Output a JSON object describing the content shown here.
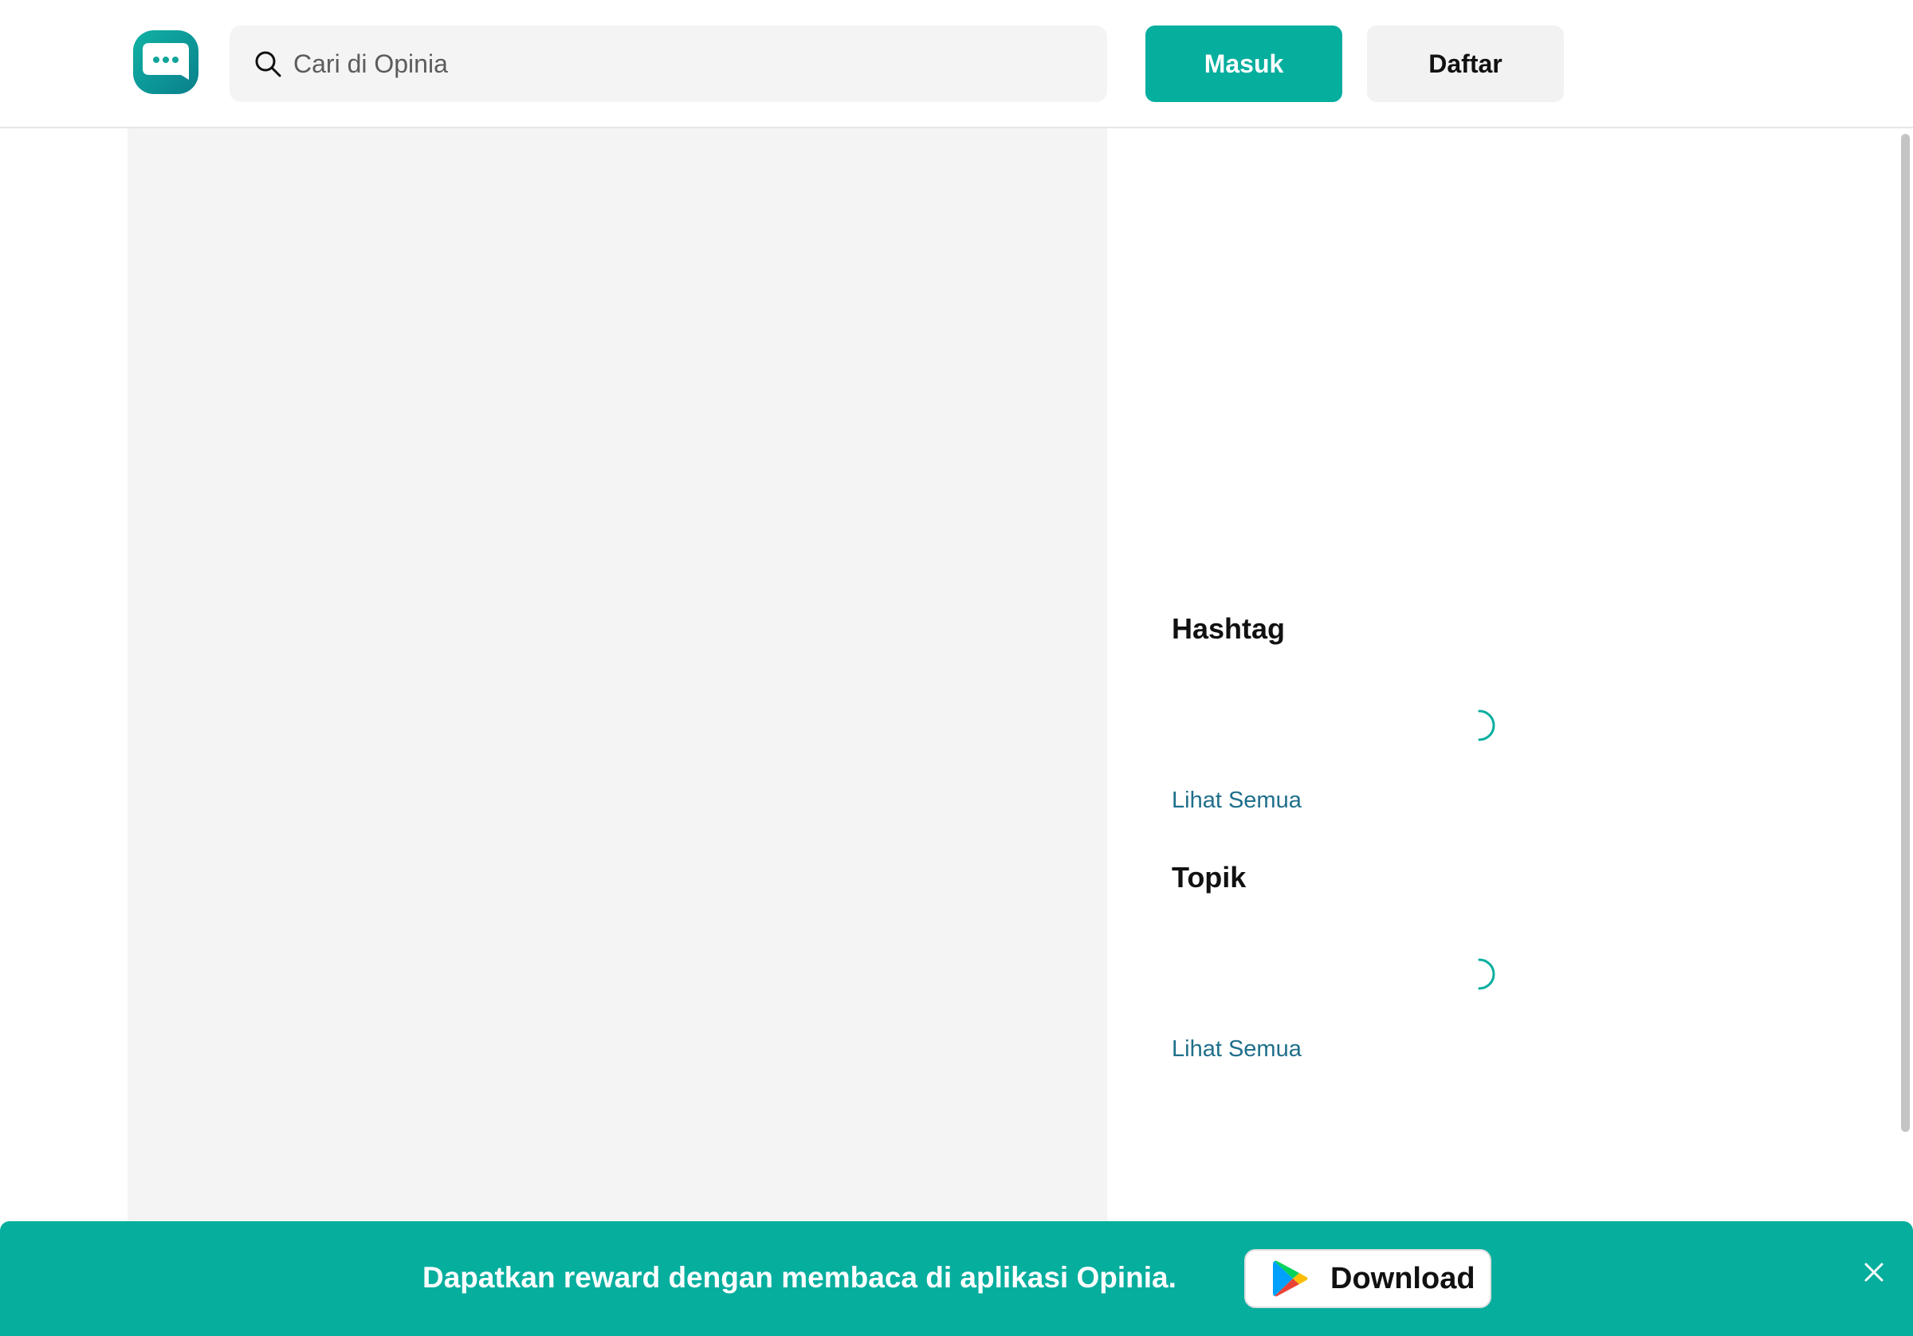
{
  "app": {
    "name": "Opinia",
    "accent_color": "#06ae9e"
  },
  "header": {
    "logo_icon": "opinia-chat-bubble-icon",
    "search": {
      "placeholder": "Cari di Opinia",
      "value": "",
      "icon": "search-icon"
    },
    "login_label": "Masuk",
    "register_label": "Daftar"
  },
  "sidebar": {
    "hashtag": {
      "title": "Hashtag",
      "see_all": "Lihat Semua",
      "loading": true
    },
    "topic": {
      "title": "Topik",
      "see_all": "Lihat Semua",
      "loading": true
    }
  },
  "banner": {
    "message": "Dapatkan reward dengan membaca di aplikasi Opinia.",
    "download_label": "Download",
    "download_icon": "google-play-icon",
    "close_icon": "close-icon",
    "background_color": "#06ae9e"
  }
}
